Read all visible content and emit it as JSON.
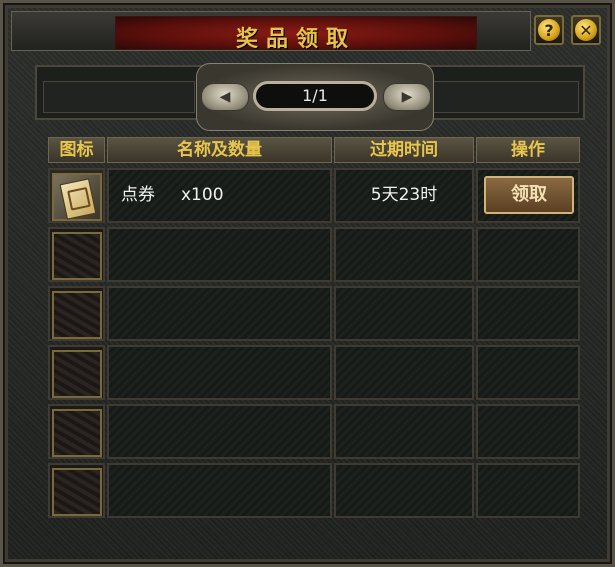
{
  "window": {
    "title": "奖品领取",
    "help_icon": "?",
    "close_icon": "✕"
  },
  "pager": {
    "text": "1/1",
    "prev_icon": "◀",
    "next_icon": "▶"
  },
  "table": {
    "headers": [
      "图标",
      "名称及数量",
      "过期时间",
      "操作"
    ],
    "rows": [
      {
        "icon": "coupon-icon",
        "name": "点券",
        "qty": "x100",
        "expire": "5天23时",
        "action": "领取"
      },
      {
        "icon": "",
        "name": "",
        "qty": "",
        "expire": "",
        "action": ""
      },
      {
        "icon": "",
        "name": "",
        "qty": "",
        "expire": "",
        "action": ""
      },
      {
        "icon": "",
        "name": "",
        "qty": "",
        "expire": "",
        "action": ""
      },
      {
        "icon": "",
        "name": "",
        "qty": "",
        "expire": "",
        "action": ""
      },
      {
        "icon": "",
        "name": "",
        "qty": "",
        "expire": "",
        "action": ""
      }
    ]
  },
  "colors": {
    "title_gold": "#e7c34a",
    "title_red": "#8a1b14",
    "header_gold": "#e8c64e"
  }
}
